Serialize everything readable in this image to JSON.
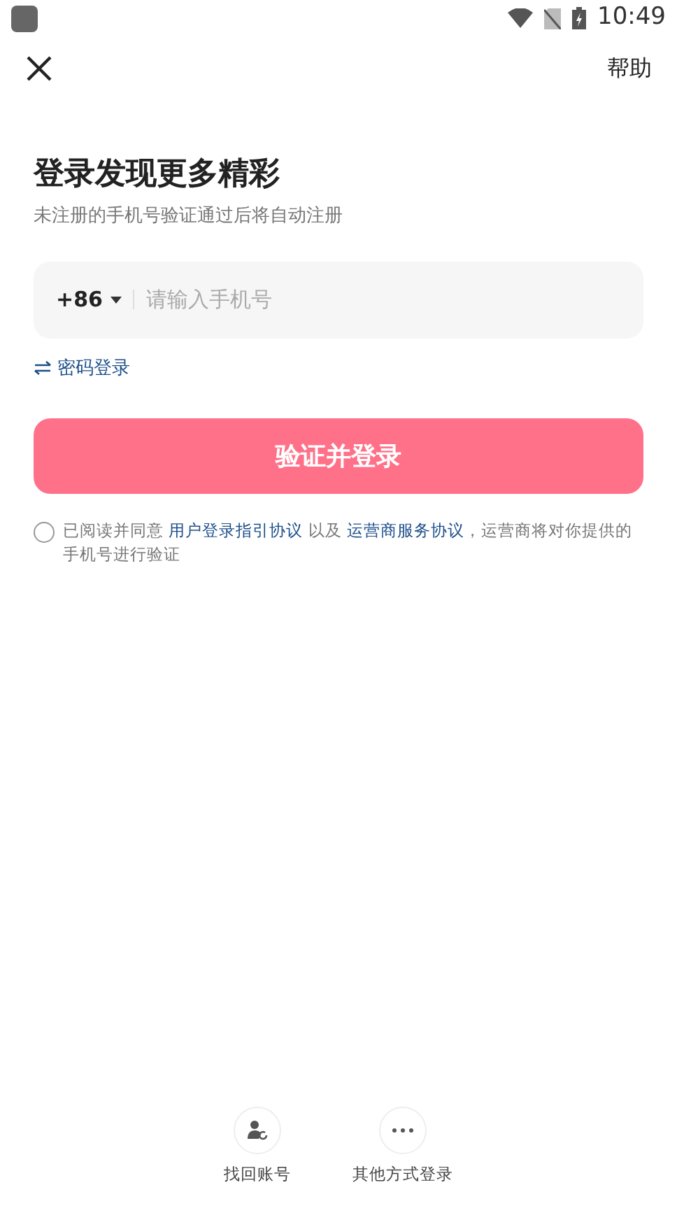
{
  "status_bar": {
    "time": "10:49"
  },
  "header": {
    "help": "帮助"
  },
  "title": "登录发现更多精彩",
  "subtitle": "未注册的手机号验证通过后将自动注册",
  "phone_field": {
    "country_code": "+86",
    "placeholder": "请输入手机号"
  },
  "password_login": "密码登录",
  "submit_button": "验证并登录",
  "agreement": {
    "checked": false,
    "parts": [
      {
        "kind": "text",
        "text": "已阅读并同意 "
      },
      {
        "kind": "link",
        "text": "用户登录指引协议"
      },
      {
        "kind": "text",
        "text": " 以及 "
      },
      {
        "kind": "link",
        "text": "运营商服务协议"
      },
      {
        "kind": "text",
        "text": "，运营商将对你提供的手机号进行验证"
      }
    ]
  },
  "bottom_actions": [
    {
      "kind": "recover",
      "label": "找回账号"
    },
    {
      "kind": "more",
      "label": "其他方式登录"
    }
  ]
}
